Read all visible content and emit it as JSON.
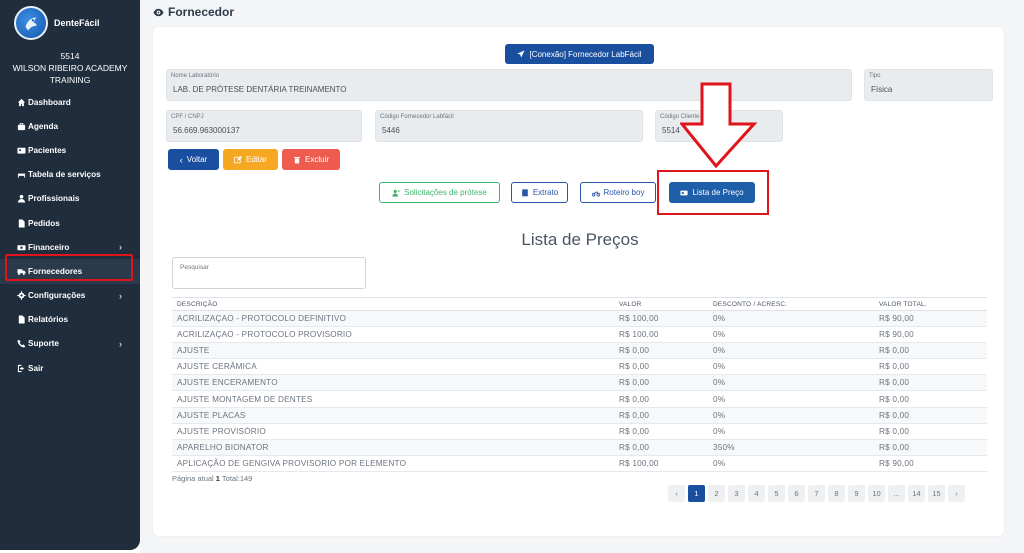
{
  "app": {
    "name": "DenteFácil"
  },
  "clinic": {
    "code": "5514",
    "name": "WILSON RIBEIRO ACADEMY TRAINING"
  },
  "sidebar": {
    "items": [
      {
        "label": "Dashboard",
        "icon": "home-icon"
      },
      {
        "label": "Agenda",
        "icon": "briefcase-icon"
      },
      {
        "label": "Pacientes",
        "icon": "id-card-icon"
      },
      {
        "label": "Tabela de serviços",
        "icon": "bed-icon"
      },
      {
        "label": "Profissionais",
        "icon": "user-icon"
      },
      {
        "label": "Pedidos",
        "icon": "file-icon"
      },
      {
        "label": "Financeiro",
        "icon": "money-icon",
        "chevron": "›"
      },
      {
        "label": "Fornecedores",
        "icon": "truck-icon"
      },
      {
        "label": "Configurações",
        "icon": "gear-icon",
        "chevron": "›"
      },
      {
        "label": "Relatórios",
        "icon": "file-icon"
      },
      {
        "label": "Suporte",
        "icon": "phone-icon",
        "chevron": "›"
      },
      {
        "label": "Sair",
        "icon": "signout-icon"
      }
    ]
  },
  "header": {
    "title": "Fornecedor"
  },
  "form": {
    "connection_button": "[Conexão] Fornecedor LabFácil",
    "nome_laboratorio": {
      "label": "Nome Laboratório",
      "value": "LAB. DE PRÓTESE DENTÁRIA TREINAMENTO"
    },
    "tipo": {
      "label": "Tipo",
      "value": "Física"
    },
    "cpf_cnpj": {
      "label": "CPF / CNPJ",
      "value": "56.669.963000137"
    },
    "codigo_fornecedor": {
      "label": "Código Fornecedor Labfácil",
      "value": "5446"
    },
    "codigo_cliente": {
      "label": "Código Cliente DenteFácil",
      "value": "5514"
    }
  },
  "actions": {
    "voltar": "Voltar",
    "editar": "Editar",
    "excluir": "Excluir"
  },
  "tabs": {
    "solicitacoes": "Solicitações de prótese",
    "extrato": "Extrato",
    "roteiro": "Roteiro boy",
    "lista": "Lista de Preço"
  },
  "price_list": {
    "title": "Lista de Preços",
    "search_placeholder": "Pesquisar",
    "columns": [
      "DESCRIÇÃO",
      "VALOR",
      "DESCONTO / ACRESC.",
      "VALOR TOTAL."
    ],
    "rows": [
      [
        "ACRILIZAÇAO - PROTOCOLO DEFINITIVO",
        "R$ 100,00",
        "0%",
        "R$ 90,00"
      ],
      [
        "ACRILIZAÇAO - PROTOCOLO PROVISORIO",
        "R$ 100,00",
        "0%",
        "R$ 90,00"
      ],
      [
        "AJUSTE",
        "R$ 0,00",
        "0%",
        "R$ 0,00"
      ],
      [
        "AJUSTE CERÂMICA",
        "R$ 0,00",
        "0%",
        "R$ 0,00"
      ],
      [
        "AJUSTE ENCERAMENTO",
        "R$ 0,00",
        "0%",
        "R$ 0,00"
      ],
      [
        "AJUSTE MONTAGEM DE DENTES",
        "R$ 0,00",
        "0%",
        "R$ 0,00"
      ],
      [
        "AJUSTE PLACAS",
        "R$ 0,00",
        "0%",
        "R$ 0,00"
      ],
      [
        "AJUSTE PROVISÓRIO",
        "R$ 0,00",
        "0%",
        "R$ 0,00"
      ],
      [
        "APARELHO BIONATOR",
        "R$ 0,00",
        "350%",
        "R$ 0,00"
      ],
      [
        "APLICAÇÃO DE GENGIVA PROVISORIO POR ELEMENTO",
        "R$ 100,00",
        "0%",
        "R$ 90,00"
      ]
    ],
    "page_info_prefix": "Página atual ",
    "page_current": "1",
    "page_info_suffix": " Total:149"
  },
  "pagination": [
    "‹",
    "1",
    "2",
    "3",
    "4",
    "5",
    "6",
    "7",
    "8",
    "9",
    "10",
    "...",
    "14",
    "15",
    "›"
  ],
  "colors": {
    "sidebar": "#1f2d3d",
    "primary": "#1a4fa0",
    "warning": "#f7a823",
    "danger": "#ee5b4f",
    "success": "#3fb56a",
    "highlight": "#e0151b"
  }
}
